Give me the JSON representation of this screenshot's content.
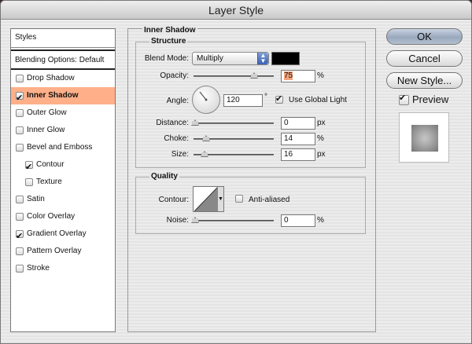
{
  "window": {
    "title": "Layer Style"
  },
  "styles_list": {
    "header": "Styles",
    "blending_options": "Blending Options: Default",
    "items": [
      {
        "label": "Drop Shadow",
        "checked": false,
        "selected": false
      },
      {
        "label": "Inner Shadow",
        "checked": true,
        "selected": true
      },
      {
        "label": "Outer Glow",
        "checked": false,
        "selected": false
      },
      {
        "label": "Inner Glow",
        "checked": false,
        "selected": false
      },
      {
        "label": "Bevel and Emboss",
        "checked": false,
        "selected": false
      },
      {
        "label": "Contour",
        "checked": true,
        "selected": false
      },
      {
        "label": "Texture",
        "checked": false,
        "selected": false
      },
      {
        "label": "Satin",
        "checked": false,
        "selected": false
      },
      {
        "label": "Color Overlay",
        "checked": false,
        "selected": false
      },
      {
        "label": "Gradient Overlay",
        "checked": true,
        "selected": false
      },
      {
        "label": "Pattern Overlay",
        "checked": false,
        "selected": false
      },
      {
        "label": "Stroke",
        "checked": false,
        "selected": false
      }
    ]
  },
  "panel": {
    "title": "Inner Shadow",
    "structure": {
      "title": "Structure",
      "blend_mode_label": "Blend Mode:",
      "blend_mode_value": "Multiply",
      "shadow_color": "#000000",
      "opacity_label": "Opacity:",
      "opacity_value": "75",
      "opacity_unit": "%",
      "angle_label": "Angle:",
      "angle_value": "120",
      "angle_unit": "°",
      "use_global_light_label": "Use Global Light",
      "use_global_light_checked": true,
      "distance_label": "Distance:",
      "distance_value": "0",
      "distance_unit": "px",
      "choke_label": "Choke:",
      "choke_value": "14",
      "choke_unit": "%",
      "size_label": "Size:",
      "size_value": "16",
      "size_unit": "px"
    },
    "quality": {
      "title": "Quality",
      "contour_label": "Contour:",
      "anti_aliased_label": "Anti-aliased",
      "anti_aliased_checked": false,
      "noise_label": "Noise:",
      "noise_value": "0",
      "noise_unit": "%"
    }
  },
  "buttons": {
    "ok": "OK",
    "cancel": "Cancel",
    "new_style": "New Style...",
    "preview_label": "Preview",
    "preview_checked": true
  },
  "colors": {
    "selected_item_bg": "#ffb089",
    "opacity_field_highlight": "#f4a27a"
  }
}
